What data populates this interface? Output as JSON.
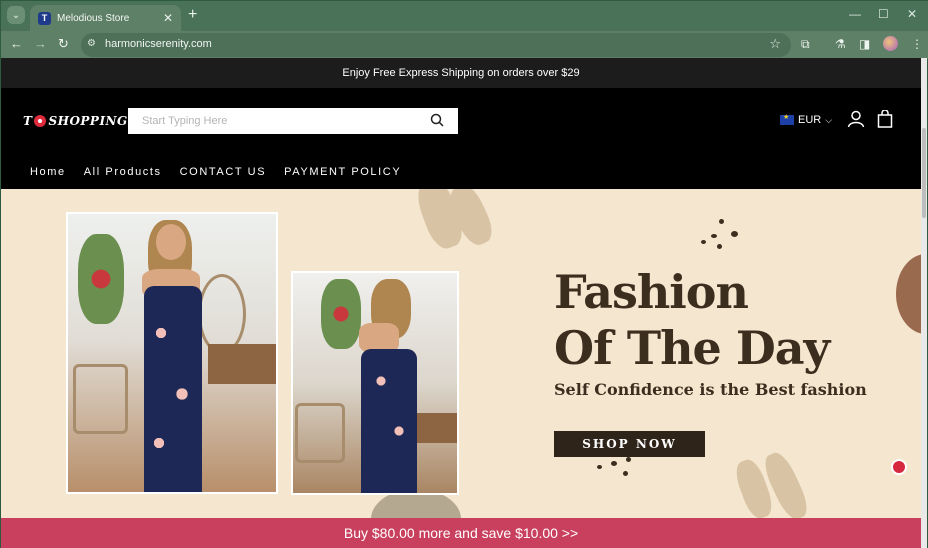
{
  "browser": {
    "tab_title": "Melodious Store",
    "tab_favicon": "T",
    "url": "harmonicserenity.com"
  },
  "page": {
    "announcement": "Enjoy Free Express Shipping on orders over $29",
    "logo_text_left": "T",
    "logo_text_right": "SHOPPING",
    "search": {
      "placeholder": "Start Typing Here"
    },
    "currency": "EUR",
    "nav": [
      "Home",
      "All Products",
      "CONTACT US",
      "PAYMENT POLICY"
    ],
    "hero": {
      "title_line1": "Fashion",
      "title_line2": "Of The Day",
      "subtitle": "Self Confidence is the Best fashion",
      "button": "SHOP NOW"
    },
    "promo": "Buy $80.00 more and save $10.00  >>"
  },
  "colors": {
    "chrome": "#5e8066",
    "hero_bg": "#f5e6cf",
    "hero_text": "#3b2e1e",
    "promo": "#c9405e",
    "button": "#2f2419"
  }
}
